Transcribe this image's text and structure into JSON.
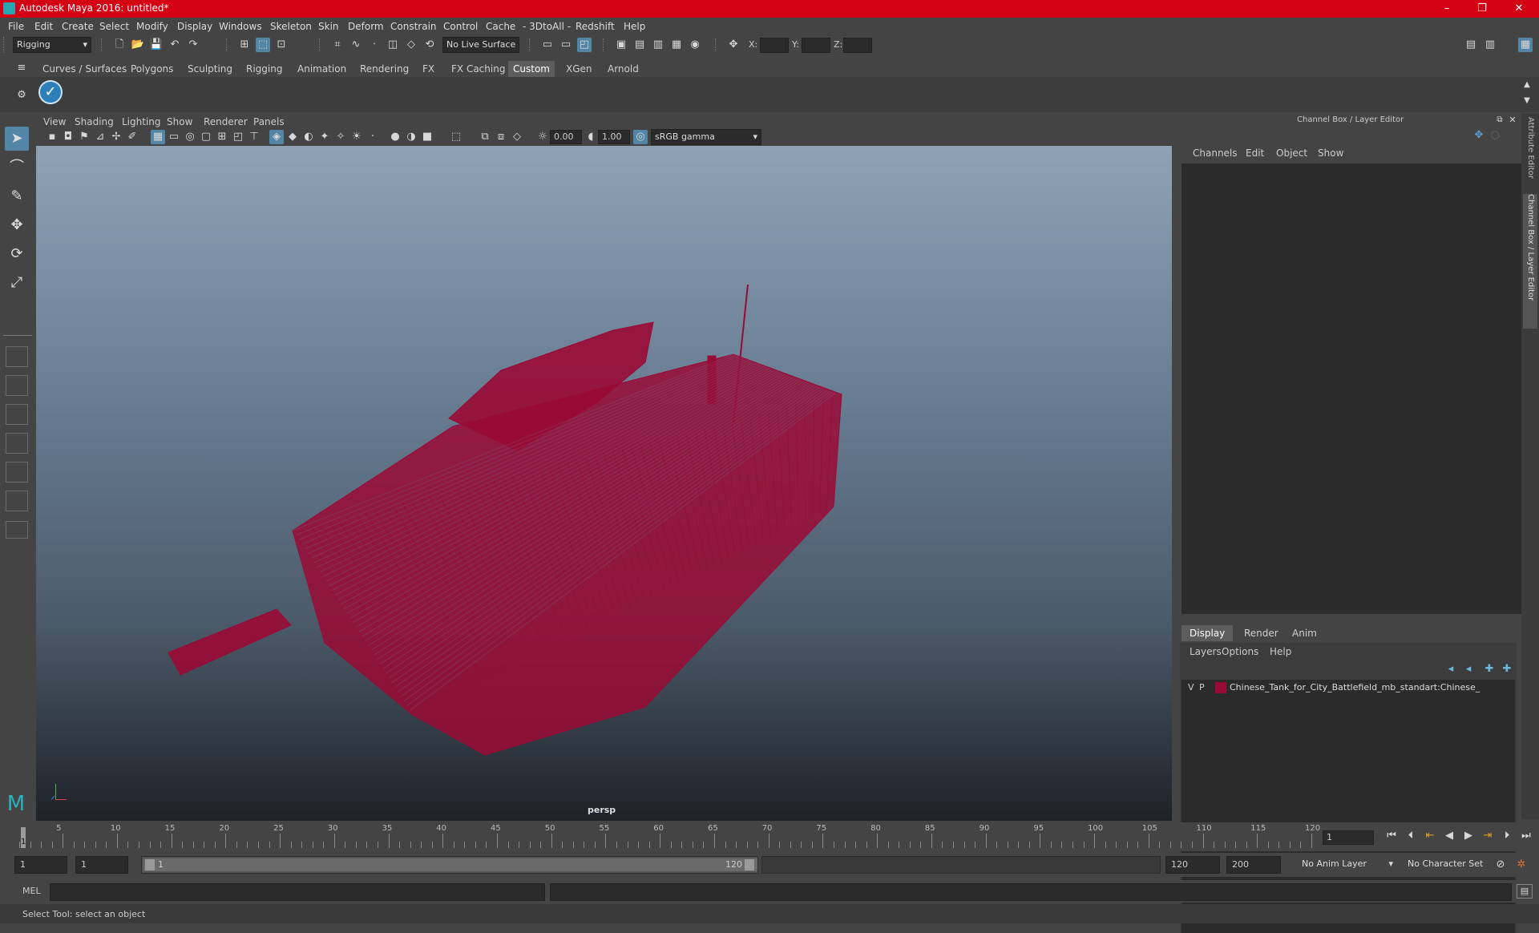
{
  "window": {
    "title": "Autodesk Maya 2016: untitled*",
    "controls": [
      "–",
      "❐",
      "✕"
    ]
  },
  "menubar": [
    "File",
    "Edit",
    "Create",
    "Select",
    "Modify",
    "Display",
    "Windows",
    "Skeleton",
    "Skin",
    "Deform",
    "Constrain",
    "Control",
    "Cache",
    "- 3DtoAll -",
    "Redshift",
    "Help"
  ],
  "statusline": {
    "mode": "Rigging",
    "live_surface": "No Live Surface",
    "x_label": "X:",
    "y_label": "Y:",
    "z_label": "Z:"
  },
  "shelf": {
    "tabs": [
      "Curves / Surfaces",
      "Polygons",
      "Sculpting",
      "Rigging",
      "Animation",
      "Rendering",
      "FX",
      "FX Caching",
      "Custom",
      "XGen",
      "Arnold"
    ],
    "active_tab": "Custom"
  },
  "viewport": {
    "menu": [
      "View",
      "Shading",
      "Lighting",
      "Show",
      "Renderer",
      "Panels"
    ],
    "exposure": "0.00",
    "gamma": "1.00",
    "color_space": "sRGB gamma",
    "camera_label": "persp",
    "wire_color": "#9a0a36"
  },
  "channelbox": {
    "title": "Channel Box / Layer Editor",
    "menu": [
      "Channels",
      "Edit",
      "Object",
      "Show"
    ]
  },
  "layer_editor": {
    "tabs": [
      "Display",
      "Render",
      "Anim"
    ],
    "active_tab": "Display",
    "menu": [
      "Layers",
      "Options",
      "Help"
    ],
    "layer": {
      "v": "V",
      "p": "P",
      "color": "#9a0a36",
      "name": "Chinese_Tank_for_City_Battlefield_mb_standart:Chinese_"
    }
  },
  "side_tabs": [
    "Attribute Editor",
    "Channel Box / Layer Editor"
  ],
  "timeline": {
    "ticks": [
      "5",
      "10",
      "15",
      "20",
      "25",
      "30",
      "35",
      "40",
      "45",
      "50",
      "55",
      "60",
      "65",
      "70",
      "75",
      "80",
      "85",
      "90",
      "95",
      "100",
      "105",
      "110",
      "115",
      "120"
    ],
    "first_tick": "1",
    "current_frame": "1"
  },
  "range": {
    "start": "1",
    "playback_start": "1",
    "slider_start": "1",
    "slider_end": "120",
    "playback_end": "120",
    "end": "200",
    "anim_layer": "No Anim Layer",
    "character_set": "No Character Set"
  },
  "commandline": {
    "label": "MEL"
  },
  "helpline": {
    "text": "Select Tool: select an object"
  }
}
